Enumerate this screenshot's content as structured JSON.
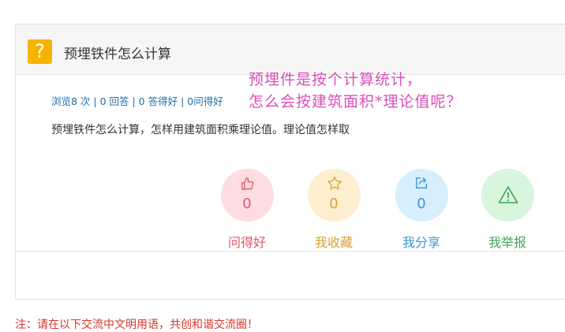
{
  "question": {
    "title": "预埋铁件怎么计算",
    "stats": "浏览8 次 | 0 回答 | 0 答得好 | 0问得好",
    "description": "预埋铁件怎么计算，怎样用建筑面积乘理论值。理论值怎样取"
  },
  "overlay_text": {
    "line1": "预埋件是按个计算统计，",
    "line2": "怎么会按建筑面积*理论值呢？",
    "color": "#d94fb8"
  },
  "actions": [
    {
      "label": "问得好",
      "count": "0",
      "icon": "thumbs-up-icon",
      "color": "#e0576a",
      "bg": "#fddde1"
    },
    {
      "label": "我收藏",
      "count": "0",
      "icon": "star-icon",
      "color": "#d8a236",
      "bg": "#fdefcf"
    },
    {
      "label": "我分享",
      "count": "0",
      "icon": "share-icon",
      "color": "#3a97d4",
      "bg": "#d7eefc"
    },
    {
      "label": "我举报",
      "count": "",
      "icon": "warning-icon",
      "color": "#3fa457",
      "bg": "#d8f5dd"
    }
  ],
  "notice": "注：请在以下交流中文明用语，共创和谐交流圈！"
}
